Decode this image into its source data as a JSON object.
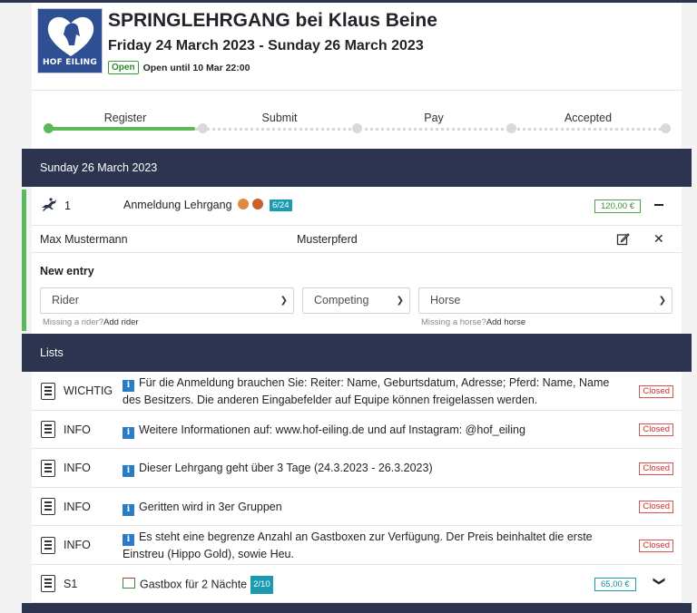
{
  "event": {
    "title": "SPRINGLEHRGANG bei Klaus Beine",
    "dates": "Friday 24 March 2023 - Sunday 26 March 2023",
    "status_badge": "Open",
    "status_text": "Open until 10 Mar 22:00",
    "logo_text": "HOF EILING"
  },
  "steps": [
    {
      "label": "Register"
    },
    {
      "label": "Submit"
    },
    {
      "label": "Pay"
    },
    {
      "label": "Accepted"
    }
  ],
  "day": {
    "header": "Sunday 26 March 2023",
    "class": {
      "number": "1",
      "name": "Anmeldung Lehrgang",
      "count": "6/24",
      "price": "120,00 €"
    },
    "entry": {
      "rider": "Max Mustermann",
      "horse": "Musterpferd"
    },
    "new_entry": {
      "heading": "New entry",
      "rider_select": "Rider",
      "competing_select": "Competing",
      "horse_select": "Horse",
      "missing_rider": "Missing a rider?",
      "add_rider": "Add rider",
      "missing_horse": "Missing a horse?",
      "add_horse": "Add horse"
    }
  },
  "lists": {
    "header": "Lists",
    "items": [
      {
        "type": "WICHTIG",
        "text": "Für die Anmeldung brauchen Sie: Reiter: Name, Geburtsdatum, Adresse; Pferd: Name, Name des Besitzers. Die anderen Eingabefelder auf Equipe können freigelassen werden.",
        "status": "Closed"
      },
      {
        "type": "INFO",
        "text": "Weitere Informationen auf: www.hof-eiling.de und auf Instagram: @hof_eiling",
        "status": "Closed"
      },
      {
        "type": "INFO",
        "text": "Dieser Lehrgang geht über 3 Tage (24.3.2023 - 26.3.2023)",
        "status": "Closed"
      },
      {
        "type": "INFO",
        "text": "Geritten wird in 3er Gruppen",
        "status": "Closed"
      },
      {
        "type": "INFO",
        "text": "Es steht eine begrenze Anzahl an Gastboxen zur Verfügung. Der Preis beinhaltet die erste Einstreu (Hippo Gold), sowie Heu.",
        "status": "Closed"
      },
      {
        "type": "S1",
        "text": "Gastbox für 2 Nächte",
        "count": "2/10",
        "price": "65,00 €"
      }
    ]
  }
}
